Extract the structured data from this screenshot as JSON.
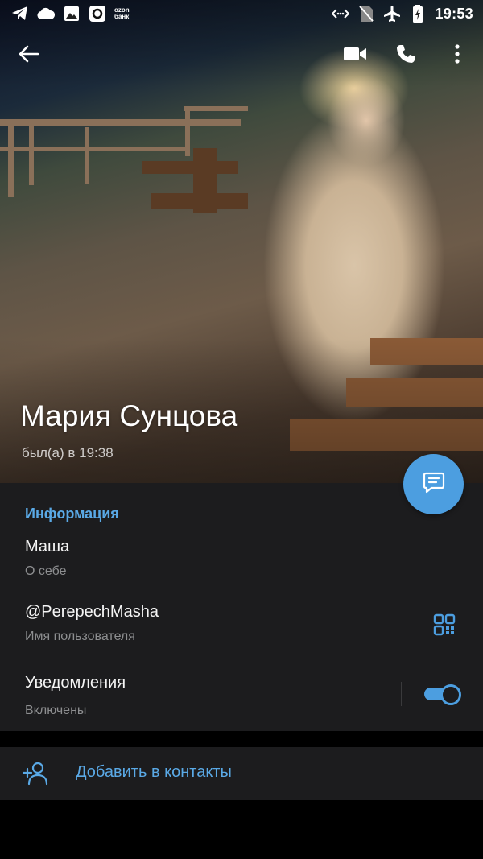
{
  "status_bar": {
    "time": "19:53",
    "ozon_label": "ozon банк"
  },
  "profile": {
    "name": "Мария Сунцова",
    "last_seen": "был(а) в 19:38"
  },
  "info": {
    "heading": "Информация",
    "bio": {
      "value": "Маша",
      "label": "О себе"
    },
    "username": {
      "value": "@PerepechMasha",
      "label": "Имя пользователя"
    },
    "notifications": {
      "value": "Уведомления",
      "label": "Включены",
      "enabled": true
    }
  },
  "actions": {
    "add_contact": "Добавить в контакты"
  },
  "colors": {
    "accent": "#4c9ee0",
    "panel": "#1c1c1e",
    "background": "#000000"
  }
}
